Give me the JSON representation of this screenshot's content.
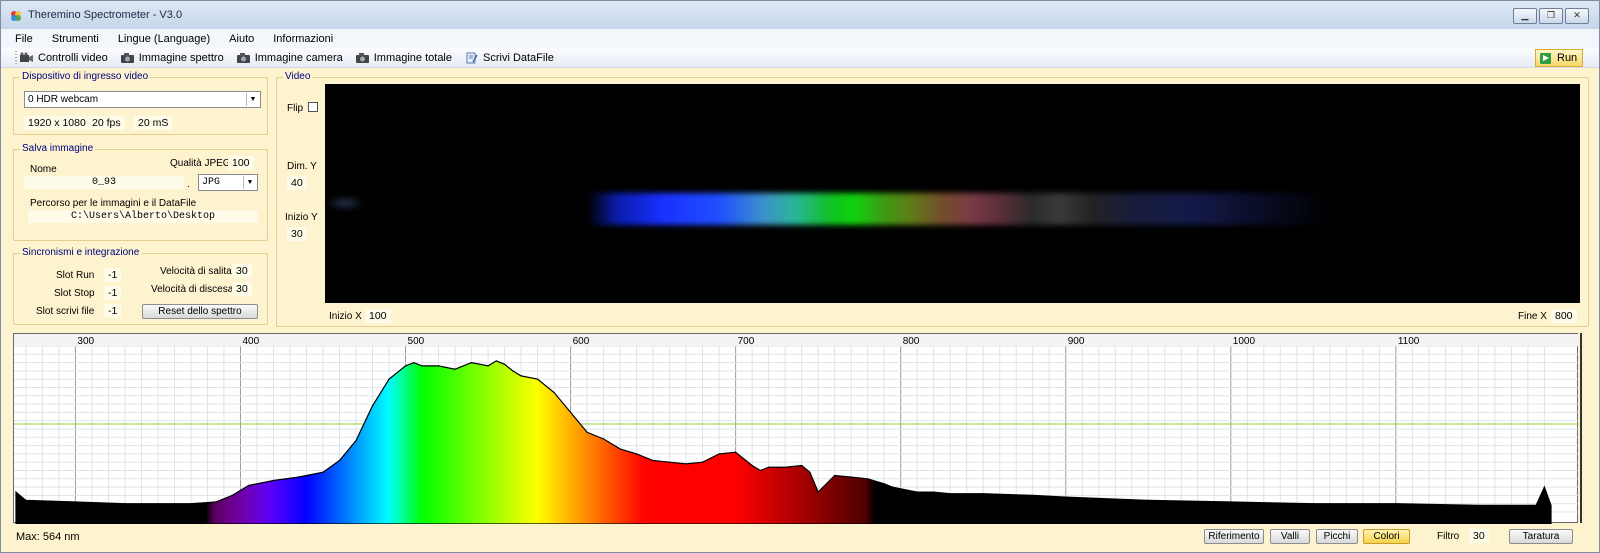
{
  "window": {
    "title": "Theremino Spectrometer - V3.0",
    "controls": [
      "minimize",
      "restore",
      "close"
    ]
  },
  "menu": [
    "File",
    "Strumenti",
    "Lingue (Language)",
    "Aiuto",
    "Informazioni"
  ],
  "toolbar": {
    "items": [
      {
        "label": "Controlli video",
        "icon": "video-camera-icon"
      },
      {
        "label": "Immagine spettro",
        "icon": "photo-camera-icon"
      },
      {
        "label": "Immagine camera",
        "icon": "photo-camera-icon"
      },
      {
        "label": "Immagine totale",
        "icon": "photo-camera-icon"
      },
      {
        "label": "Scrivi DataFile",
        "icon": "write-file-icon"
      }
    ],
    "run_label": "Run"
  },
  "video_input": {
    "group_title": "Dispositivo di ingresso video",
    "device": "0 HDR webcam",
    "resolution": "1920 x 1080",
    "fps": "20 fps",
    "exposure": "20 mS"
  },
  "save_image": {
    "group_title": "Salva immagine",
    "name_label": "Nome",
    "name_value": "0_93",
    "jpeg_quality_label": "Qualità JPEG",
    "jpeg_quality_value": "100",
    "dot": ".",
    "format": "JPG",
    "path_label": "Percorso per le immagini e il DataFile",
    "path_value": "C:\\Users\\Alberto\\Desktop"
  },
  "sync": {
    "group_title": "Sincronismi e integrazione",
    "slot_run_label": "Slot Run",
    "slot_run_value": "-1",
    "slot_stop_label": "Slot Stop",
    "slot_stop_value": "-1",
    "slot_write_label": "Slot scrivi file",
    "slot_write_value": "-1",
    "rise_speed_label": "Velocità di salita",
    "rise_speed_value": "30",
    "fall_speed_label": "Velocità di discesa",
    "fall_speed_value": "30",
    "reset_label": "Reset dello spettro"
  },
  "video": {
    "group_title": "Video",
    "flip_label": "Flip",
    "flip_checked": false,
    "dim_y_label": "Dim. Y",
    "dim_y_value": "40",
    "start_y_label": "Inizio Y",
    "start_y_value": "30",
    "start_x_label": "Inizio X",
    "start_x_value": "100",
    "end_x_label": "Fine X",
    "end_x_value": "800"
  },
  "chart_data": {
    "type": "area",
    "title": "",
    "xlabel": "",
    "ylabel": "",
    "x_ticks": [
      300,
      400,
      500,
      600,
      700,
      800,
      900,
      1000,
      1100
    ],
    "xlim": [
      264,
      1194
    ],
    "ylim": [
      0,
      100
    ],
    "grid": true,
    "reference_line_y": 53,
    "fill": "spectrum-colors",
    "x": [
      264,
      270,
      300,
      330,
      350,
      370,
      385,
      395,
      405,
      420,
      435,
      450,
      460,
      470,
      480,
      490,
      500,
      505,
      510,
      520,
      530,
      540,
      550,
      555,
      560,
      565,
      570,
      580,
      590,
      600,
      610,
      620,
      630,
      640,
      650,
      660,
      670,
      680,
      690,
      700,
      710,
      715,
      720,
      725,
      730,
      740,
      745,
      750,
      760,
      770,
      780,
      790,
      795,
      800,
      810,
      820,
      830,
      850,
      880,
      900,
      950,
      1000,
      1050,
      1100,
      1150,
      1185,
      1190,
      1194
    ],
    "y": [
      12,
      7,
      6,
      5,
      5,
      5,
      6,
      10,
      16,
      19,
      21,
      24,
      31,
      43,
      64,
      80,
      88,
      90,
      88,
      88,
      86,
      90,
      88,
      91,
      89,
      85,
      82,
      80,
      72,
      60,
      48,
      44,
      38,
      35,
      31,
      30,
      29,
      30,
      35,
      36,
      28,
      25,
      27,
      27,
      27,
      28,
      24,
      12,
      22,
      21,
      20,
      17,
      15,
      14,
      12,
      12,
      11,
      11,
      10,
      9,
      7,
      6,
      5,
      5,
      4,
      4,
      15,
      4
    ],
    "max_label": "Max: 564 nm"
  },
  "bottom": {
    "max_text": "Max: 564 nm",
    "buttons": [
      "Riferimento",
      "Valli",
      "Picchi",
      "Colori"
    ],
    "active_button": "Colori",
    "filter_label": "Filtro",
    "filter_value": "30",
    "calibrate_label": "Taratura"
  },
  "colors": {
    "panel_bg": "#fdf3cf",
    "group_title": "#000080",
    "active_button": "#f5d24a",
    "reference_line": "#9acd32"
  }
}
